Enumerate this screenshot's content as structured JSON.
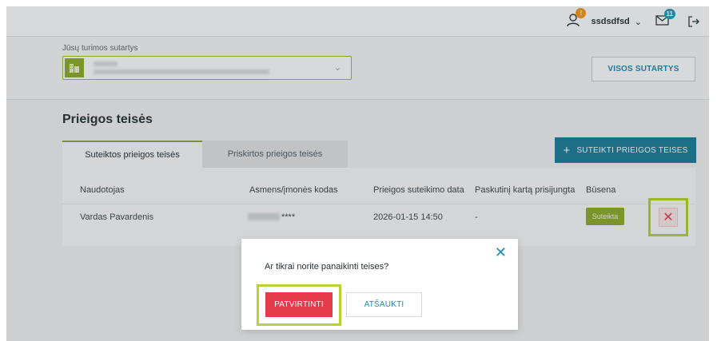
{
  "header": {
    "username": "ssdsdfsd",
    "notifications_count": "!",
    "messages_count": "11",
    "icons": [
      "user-icon",
      "chevron-down-icon",
      "mail-icon",
      "logout-icon"
    ]
  },
  "contracts": {
    "label": "Jūsų turimos sutartys",
    "all_contracts_label": "VISOS SUTARTYS"
  },
  "page": {
    "title": "Prieigos teisės",
    "tabs": [
      {
        "label": "Suteiktos prieigos teisės",
        "active": true
      },
      {
        "label": "Priskirtos prieigos teisės",
        "active": false
      }
    ],
    "grant_button_label": "SUTEIKTI PRIEIGOS TEISES"
  },
  "table": {
    "columns": [
      "Naudotojas",
      "Asmens/įmonės kodas",
      "Prieigos suteikimo data",
      "Paskutinį kartą prisijungta",
      "Būsena"
    ],
    "rows": [
      {
        "user": "Vardas Pavardenis",
        "code": "****",
        "granted": "2026-01-15 14:50",
        "last_login": "-",
        "status": "Suteikta"
      }
    ]
  },
  "modal": {
    "question": "Ar tikrai norite panaikinti teises?",
    "confirm_label": "PATVIRTINTI",
    "cancel_label": "ATŠAUKTI"
  },
  "colors": {
    "accent_green": "#8dae2a",
    "highlight_green": "#b5d334",
    "teal": "#1c7d9a",
    "danger": "#e63b4b"
  }
}
